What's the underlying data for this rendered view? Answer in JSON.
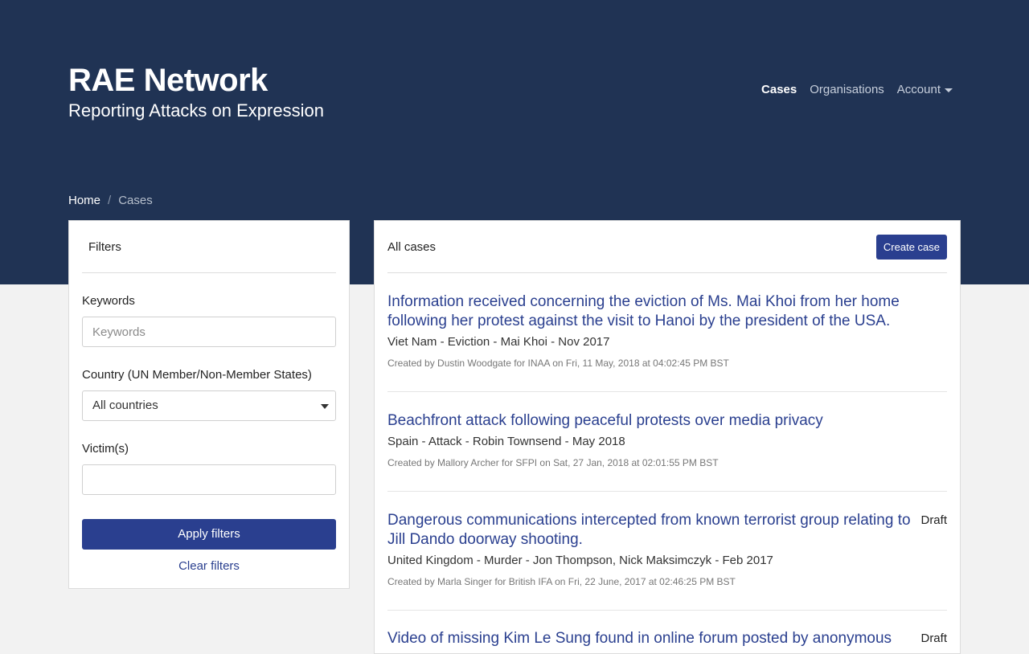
{
  "brand": {
    "title": "RAE Network",
    "subtitle": "Reporting Attacks on Expression"
  },
  "nav": {
    "cases": "Cases",
    "organisations": "Organisations",
    "account": "Account"
  },
  "breadcrumb": {
    "home": "Home",
    "separator": "/",
    "current": "Cases"
  },
  "filters": {
    "title": "Filters",
    "keywords_label": "Keywords",
    "keywords_placeholder": "Keywords",
    "country_label": "Country (UN Member/Non-Member States)",
    "country_selected": "All countries",
    "victims_label": "Victim(s)",
    "apply_label": "Apply filters",
    "clear_label": "Clear filters"
  },
  "cases_panel": {
    "title": "All cases",
    "create_label": "Create case",
    "items": [
      {
        "title": "Information received concerning the eviction of Ms. Mai Khoi from her home following her protest against the visit to Hanoi by the president of the USA.",
        "meta": "Viet Nam - Eviction - Mai Khoi - Nov 2017",
        "created": "Created by Dustin Woodgate for INAA on Fri, 11 May, 2018 at 04:02:45 PM BST",
        "status": ""
      },
      {
        "title": "Beachfront attack following peaceful protests over media privacy",
        "meta": "Spain - Attack - Robin Townsend - May 2018",
        "created": "Created by Mallory Archer for SFPI on Sat, 27 Jan, 2018 at 02:01:55 PM BST",
        "status": ""
      },
      {
        "title": "Dangerous communications intercepted from known terrorist group relating to Jill Dando doorway shooting.",
        "meta": "United Kingdom - Murder - Jon Thompson, Nick Maksimczyk - Feb 2017",
        "created": "Created by Marla Singer for British IFA on Fri, 22 June, 2017 at 02:46:25 PM BST",
        "status": "Draft"
      },
      {
        "title": "Video of missing Kim Le Sung found in online forum posted by anonymous",
        "meta": "",
        "created": "",
        "status": "Draft"
      }
    ]
  }
}
